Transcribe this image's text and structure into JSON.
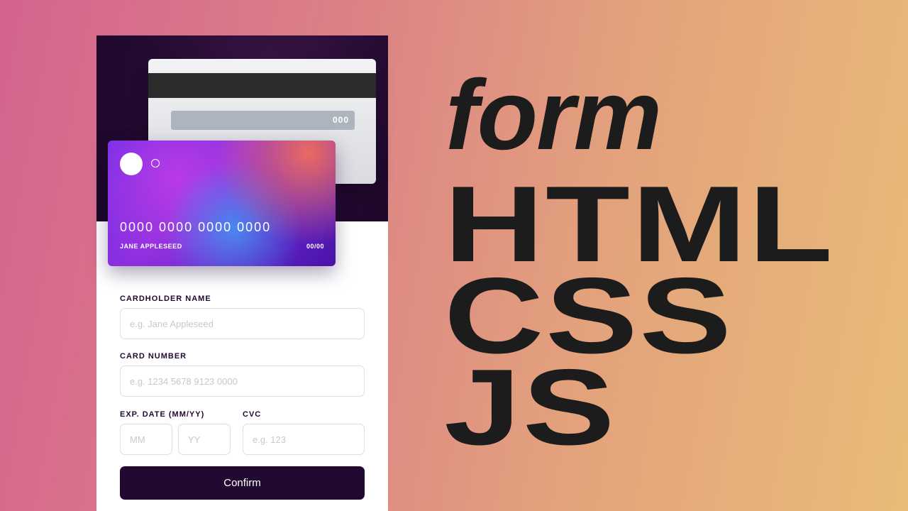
{
  "card_back": {
    "cvc": "000"
  },
  "card_front": {
    "number": "0000 0000 0000 0000",
    "holder": "JANE APPLESEED",
    "expiry": "00/00"
  },
  "form": {
    "cardholder_label": "CARDHOLDER NAME",
    "cardholder_placeholder": "e.g. Jane Appleseed",
    "number_label": "CARD NUMBER",
    "number_placeholder": "e.g. 1234 5678 9123 0000",
    "exp_label": "EXP. DATE (MM/YY)",
    "mm_placeholder": "MM",
    "yy_placeholder": "YY",
    "cvc_label": "CVC",
    "cvc_placeholder": "e.g. 123",
    "confirm_label": "Confirm"
  },
  "headline": {
    "line1": "form",
    "line2": "HTML",
    "line3": "CSS",
    "line4": "JS"
  },
  "colors": {
    "dark": "#21092f",
    "card_gradient_start": "#6a2ee8",
    "card_gradient_end": "#4a12a8",
    "background_start": "#d4638f",
    "background_end": "#e8bc77"
  }
}
